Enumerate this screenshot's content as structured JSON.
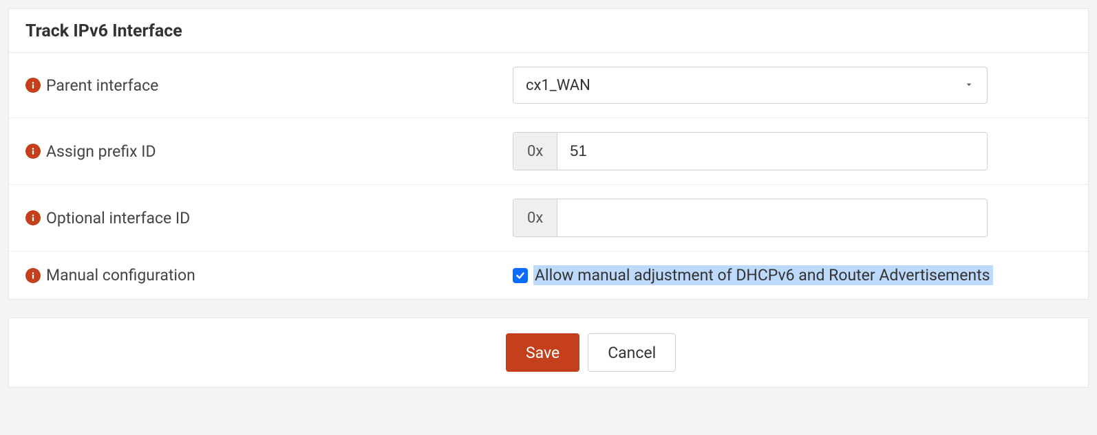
{
  "panel": {
    "title": "Track IPv6 Interface"
  },
  "fields": {
    "parent_interface": {
      "label": "Parent interface",
      "value": "cx1_WAN"
    },
    "assign_prefix_id": {
      "label": "Assign prefix ID",
      "prefix": "0x",
      "value": "51"
    },
    "optional_interface_id": {
      "label": "Optional interface ID",
      "prefix": "0x",
      "value": ""
    },
    "manual_configuration": {
      "label": "Manual configuration",
      "checkbox_label": "Allow manual adjustment of DHCPv6 and Router Advertisements",
      "checked": true
    }
  },
  "buttons": {
    "save": "Save",
    "cancel": "Cancel"
  }
}
